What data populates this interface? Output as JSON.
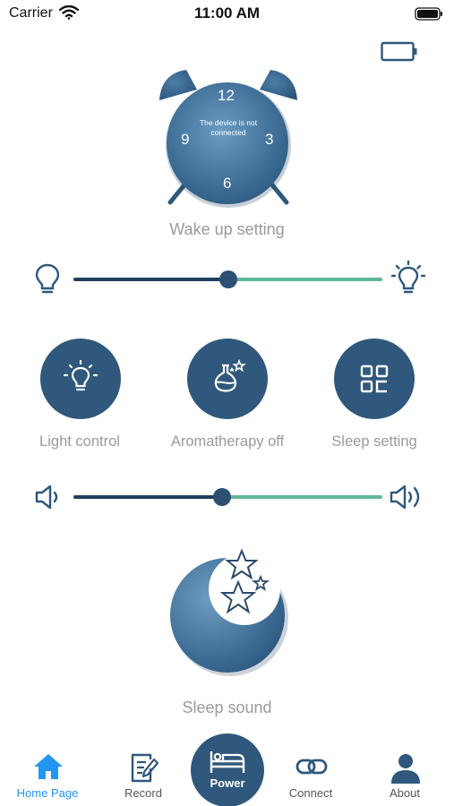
{
  "status_bar": {
    "carrier": "Carrier",
    "time": "11:00 AM"
  },
  "clock": {
    "numbers": {
      "twelve": "12",
      "three": "3",
      "six": "6",
      "nine": "9"
    },
    "message": "The device is not connected",
    "caption": "Wake up setting"
  },
  "brightness_slider": {
    "value_fraction": 0.5
  },
  "controls": [
    {
      "label": "Light control"
    },
    {
      "label": "Aromatherapy off"
    },
    {
      "label": "Sleep setting"
    }
  ],
  "volume_slider": {
    "value_fraction": 0.48
  },
  "sleep_sound": {
    "caption": "Sleep sound"
  },
  "tabs": {
    "home": "Home Page",
    "record": "Record",
    "power": "Power",
    "connect": "Connect",
    "about": "About",
    "active": "home"
  },
  "colors": {
    "primary": "#2f587c",
    "track_dark": "#1f3f61",
    "track_light": "#5fb79a",
    "active_tab": "#2196f3",
    "caption_gray": "#9a9a9a"
  },
  "icons": [
    "wifi-icon",
    "battery-icon",
    "bulb-off-icon",
    "bulb-on-icon",
    "speaker-low-icon",
    "speaker-high-icon",
    "home-icon",
    "record-icon",
    "bed-icon",
    "link-icon",
    "user-icon"
  ]
}
